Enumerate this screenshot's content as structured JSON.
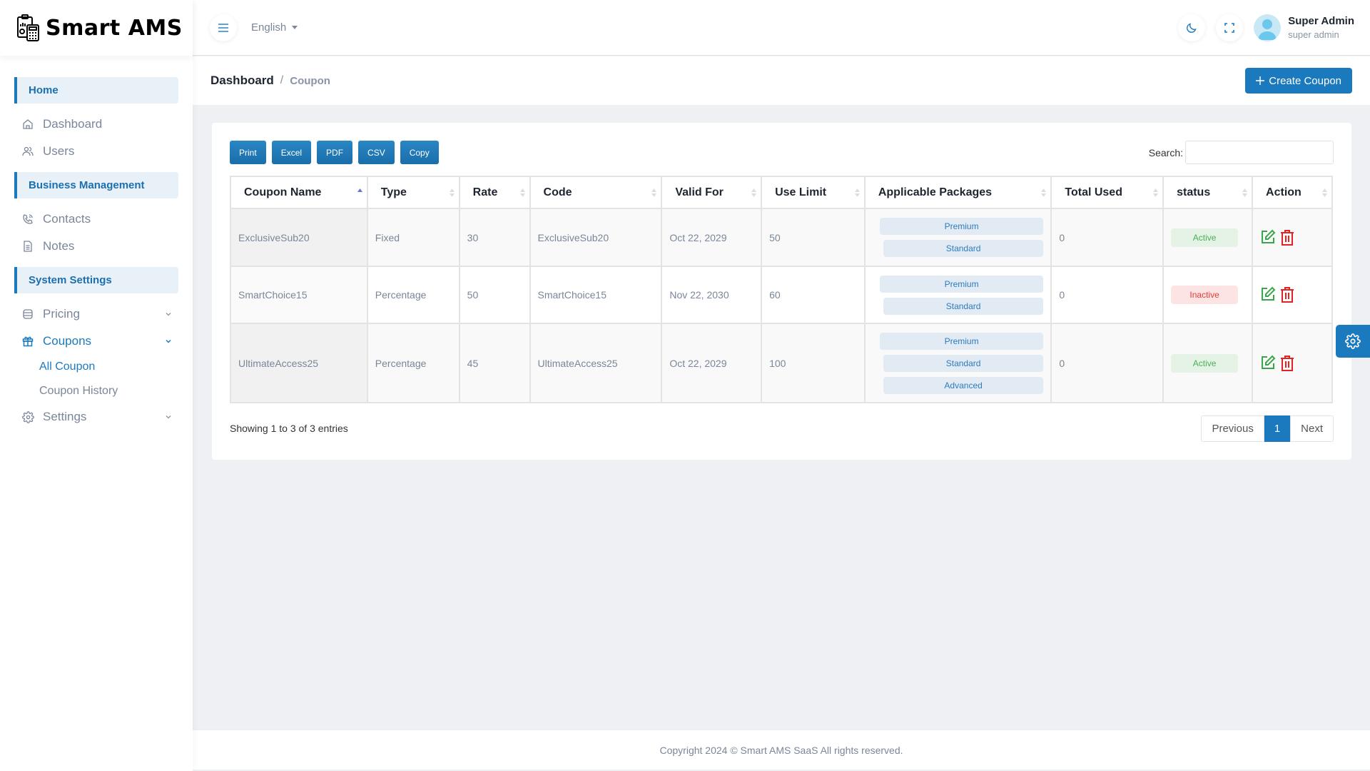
{
  "app": {
    "name": "Smart AMS"
  },
  "sidebar": {
    "sections": [
      {
        "title": "Home"
      },
      {
        "title": "Business Management"
      },
      {
        "title": "System Settings"
      }
    ],
    "items": {
      "dashboard": "Dashboard",
      "users": "Users",
      "contacts": "Contacts",
      "notes": "Notes",
      "pricing": "Pricing",
      "coupons": "Coupons",
      "all_coupon": "All Coupon",
      "coupon_history": "Coupon History",
      "settings": "Settings"
    }
  },
  "header": {
    "language": "English",
    "user_name": "Super Admin",
    "user_role": "super admin"
  },
  "breadcrumb": {
    "parent": "Dashboard",
    "separator": "/",
    "current": "Coupon"
  },
  "create_button": "Create Coupon",
  "export_buttons": [
    "Print",
    "Excel",
    "PDF",
    "CSV",
    "Copy"
  ],
  "search": {
    "label": "Search:",
    "value": "",
    "placeholder": ""
  },
  "table": {
    "columns": [
      "Coupon Name",
      "Type",
      "Rate",
      "Code",
      "Valid For",
      "Use Limit",
      "Applicable Packages",
      "Total Used",
      "status",
      "Action"
    ],
    "sorted_column": "Coupon Name",
    "sort_direction": "asc",
    "rows": [
      {
        "name": "ExclusiveSub20",
        "type": "Fixed",
        "rate": "30",
        "code": "ExclusiveSub20",
        "valid_for": "Oct 22, 2029",
        "use_limit": "50",
        "packages": [
          "Premium",
          "Standard"
        ],
        "total_used": "0",
        "status": "Active"
      },
      {
        "name": "SmartChoice15",
        "type": "Percentage",
        "rate": "50",
        "code": "SmartChoice15",
        "valid_for": "Nov 22, 2030",
        "use_limit": "60",
        "packages": [
          "Premium",
          "Standard"
        ],
        "total_used": "0",
        "status": "Inactive"
      },
      {
        "name": "UltimateAccess25",
        "type": "Percentage",
        "rate": "45",
        "code": "UltimateAccess25",
        "valid_for": "Oct 22, 2029",
        "use_limit": "100",
        "packages": [
          "Premium",
          "Standard",
          "Advanced"
        ],
        "total_used": "0",
        "status": "Active"
      }
    ]
  },
  "table_info": "Showing 1 to 3 of 3 entries",
  "pagination": {
    "previous": "Previous",
    "current": "1",
    "next": "Next"
  },
  "footer": "Copyright 2024 © Smart AMS SaaS All rights reserved.",
  "colors": {
    "primary": "#1b7abd",
    "active": "#4caf50",
    "inactive": "#e53935"
  }
}
